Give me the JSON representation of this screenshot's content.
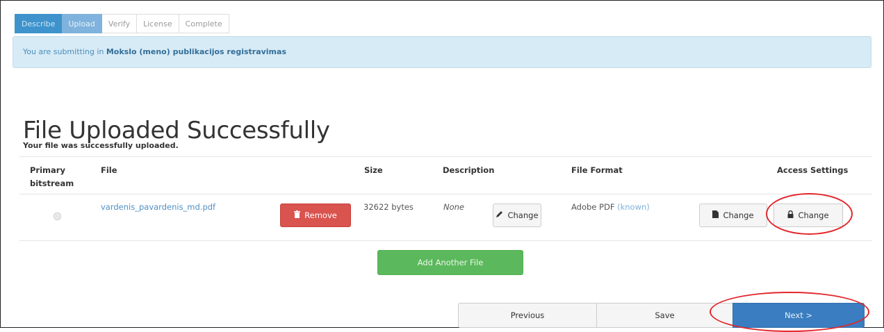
{
  "steps": [
    {
      "label": "Describe",
      "state": "done"
    },
    {
      "label": "Upload",
      "state": "active"
    },
    {
      "label": "Verify",
      "state": "todo"
    },
    {
      "label": "License",
      "state": "todo"
    },
    {
      "label": "Complete",
      "state": "todo"
    }
  ],
  "alert": {
    "prefix": "You are submitting in",
    "collection": "Mokslo (meno) publikacijos registravimas"
  },
  "page": {
    "title": "File Uploaded Successfully",
    "subtitle": "Your file was successfully uploaded."
  },
  "table": {
    "headers": {
      "primary_line1": "Primary",
      "primary_line2": "bitstream",
      "file": "File",
      "size": "Size",
      "description": "Description",
      "format": "File Format",
      "access": "Access Settings"
    },
    "row": {
      "filename": "vardenis_pavardenis_md.pdf",
      "remove_label": "Remove",
      "size": "32622 bytes",
      "description": "None",
      "description_change": "Change",
      "format": "Adobe PDF",
      "format_status": "(known)",
      "format_change": "Change",
      "access_change": "Change"
    }
  },
  "add_another_label": "Add Another File",
  "nav": {
    "previous": "Previous",
    "save": "Save",
    "next": "Next >"
  },
  "colors": {
    "highlight_oval": "#e3262b",
    "primary": "#3a7dc0",
    "success": "#5cb85c",
    "danger": "#d9534f"
  }
}
